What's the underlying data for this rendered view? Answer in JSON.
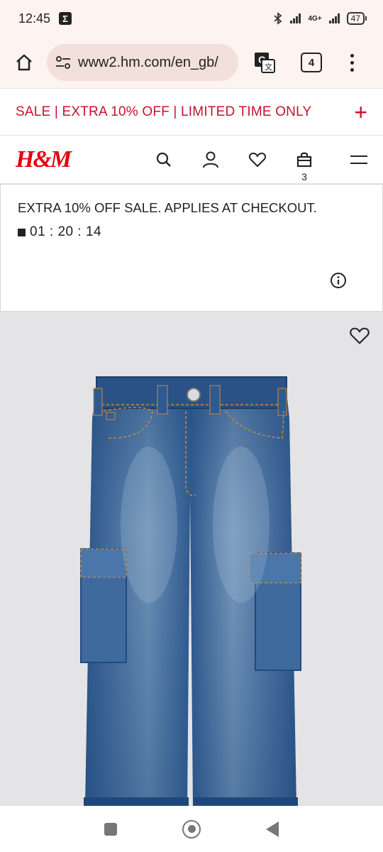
{
  "status": {
    "time": "12:45",
    "notification_icon": "sigma-icon",
    "network": "4G+",
    "battery": "47"
  },
  "browser": {
    "url": "www2.hm.com/en_gb/",
    "tab_count": "4"
  },
  "promo_banner": {
    "text": "SALE | EXTRA 10% OFF | LIMITED TIME ONLY",
    "expand_symbol": "+"
  },
  "header": {
    "logo": "H&M",
    "bag_count": "3"
  },
  "sale_box": {
    "title": "EXTRA 10% OFF SALE. APPLIES AT CHECKOUT.",
    "countdown": "01 : 20 : 14"
  },
  "colors": {
    "brand_red": "#e50010",
    "promo_red": "#c8102e",
    "product_bg": "#e4e4e6",
    "denim": "#2f5a8f"
  }
}
